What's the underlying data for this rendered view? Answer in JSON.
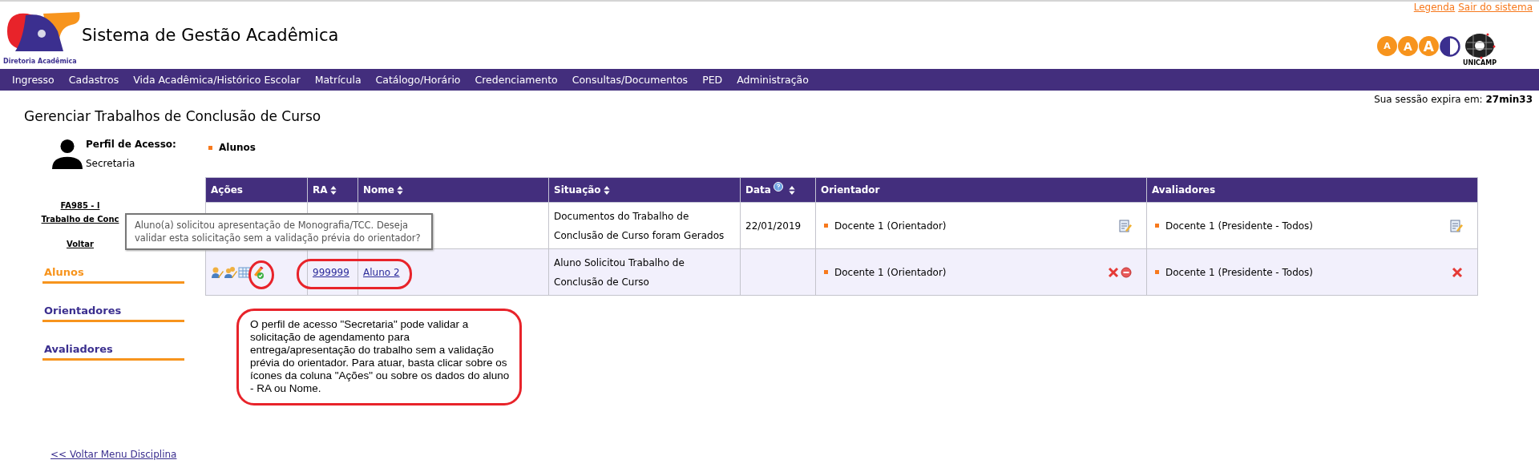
{
  "header": {
    "logo_caption": "Diretoria Acadêmica",
    "title": "Sistema de Gestão Acadêmica",
    "links": [
      "Legenda",
      "Sair do sistema"
    ],
    "font_buttons": [
      "A",
      "A",
      "A"
    ],
    "university": "UNICAMP"
  },
  "nav": [
    "Ingresso",
    "Cadastros",
    "Vida Acadêmica/Histórico Escolar",
    "Matrícula",
    "Catálogo/Horário",
    "Credenciamento",
    "Consultas/Documentos",
    "PED",
    "Administração"
  ],
  "session": {
    "label": "Sua sessão expira em:",
    "time": "27min33"
  },
  "page_title": "Gerenciar Trabalhos de Conclusão de Curso",
  "profile": {
    "label": "Perfil de Acesso:",
    "value": "Secretaria"
  },
  "sidebar": {
    "course_code": "FA985 - l",
    "course_name": "Trabalho de Conc",
    "back": "Voltar",
    "sections": [
      {
        "label": "Alunos",
        "selected": true
      },
      {
        "label": "Orientadores",
        "selected": false
      },
      {
        "label": "Avaliadores",
        "selected": false
      }
    ],
    "bottom_link": "<< Voltar Menu Disciplina"
  },
  "section_title": "Alunos",
  "table": {
    "columns": [
      {
        "label": "Ações",
        "sortable": false,
        "help": false
      },
      {
        "label": "RA",
        "sortable": true,
        "help": false
      },
      {
        "label": "Nome",
        "sortable": true,
        "help": false
      },
      {
        "label": "Situação",
        "sortable": true,
        "help": false
      },
      {
        "label": "Data",
        "sortable": true,
        "help": true
      },
      {
        "label": "Orientador",
        "sortable": false,
        "help": false
      },
      {
        "label": "Avaliadores",
        "sortable": false,
        "help": false
      }
    ],
    "rows": [
      {
        "actions": [],
        "ra": "",
        "name": "",
        "status": "Documentos do Trabalho de Conclusão de Curso foram Gerados",
        "date": "22/01/2019",
        "advisor": "Docente 1 (Orientador)",
        "advisor_actions": [
          {
            "kind": "edit"
          }
        ],
        "evaluator": "Docente 1 (Presidente - Todos)",
        "evaluator_actions": [
          {
            "kind": "edit"
          }
        ]
      },
      {
        "actions": [
          {
            "kind": "edit-person"
          },
          {
            "kind": "edit-people"
          },
          {
            "kind": "table"
          },
          {
            "kind": "validate"
          }
        ],
        "ra": "999999",
        "name": "Aluno 2",
        "status": "Aluno Solicitou Trabalho de Conclusão de Curso",
        "date": "",
        "advisor": "Docente 1 (Orientador)",
        "advisor_actions": [
          {
            "kind": "delete"
          },
          {
            "kind": "remove"
          }
        ],
        "evaluator": "Docente 1 (Presidente - Todos)",
        "evaluator_actions": [
          {
            "kind": "delete"
          }
        ]
      }
    ]
  },
  "tooltip": "Aluno(a) solicitou apresentação de Monografia/TCC. Deseja validar esta solicitação sem a validação prévia do orientador?",
  "annotation": "O perfil de acesso \"Secretaria\" pode validar a solicitação de agendamento para entrega/apresentação do trabalho sem a validação prévia do orientador. Para atuar, basta clicar sobre os ícones da coluna \"Ações\" ou sobre os dados do aluno - RA ou Nome."
}
